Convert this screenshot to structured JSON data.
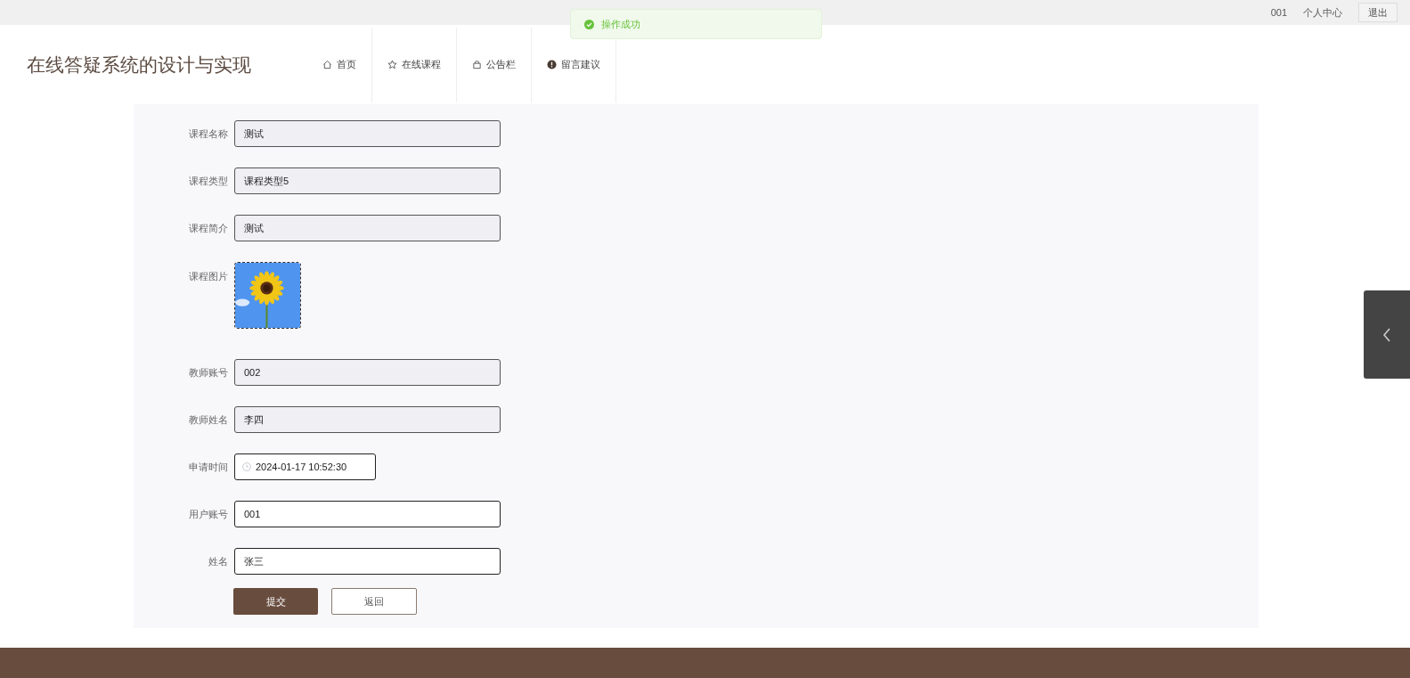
{
  "top_bar": {
    "user": "001",
    "profile_link": "个人中心",
    "logout_button": "退出"
  },
  "toast": {
    "message": "操作成功"
  },
  "header": {
    "title": "在线答疑系统的设计与实现",
    "nav": [
      {
        "label": "首页"
      },
      {
        "label": "在线课程"
      },
      {
        "label": "公告栏"
      },
      {
        "label": "留言建议"
      }
    ]
  },
  "form": {
    "fields": [
      {
        "kind": "text",
        "label": "课程名称",
        "value": "测试",
        "readonly": true
      },
      {
        "kind": "text",
        "label": "课程类型",
        "value": "课程类型5",
        "readonly": true
      },
      {
        "kind": "text",
        "label": "课程简介",
        "value": "测试",
        "readonly": true
      },
      {
        "label": "课程图片"
      },
      {
        "kind": "text",
        "label": "教师账号",
        "value": "002",
        "readonly": true
      },
      {
        "kind": "text",
        "label": "教师姓名",
        "value": "李四",
        "readonly": true
      },
      {
        "kind": "date",
        "label": "申请时间",
        "value": "2024-01-17 10:52:30",
        "readonly": false
      },
      {
        "kind": "text",
        "label": "用户账号",
        "value": "001",
        "readonly": false
      },
      {
        "kind": "text",
        "label": "姓名",
        "value": "张三",
        "readonly": false
      }
    ],
    "buttons": [
      {
        "kind": "primary",
        "label": "提交"
      },
      {
        "kind": "secondary",
        "label": "返回"
      }
    ]
  }
}
